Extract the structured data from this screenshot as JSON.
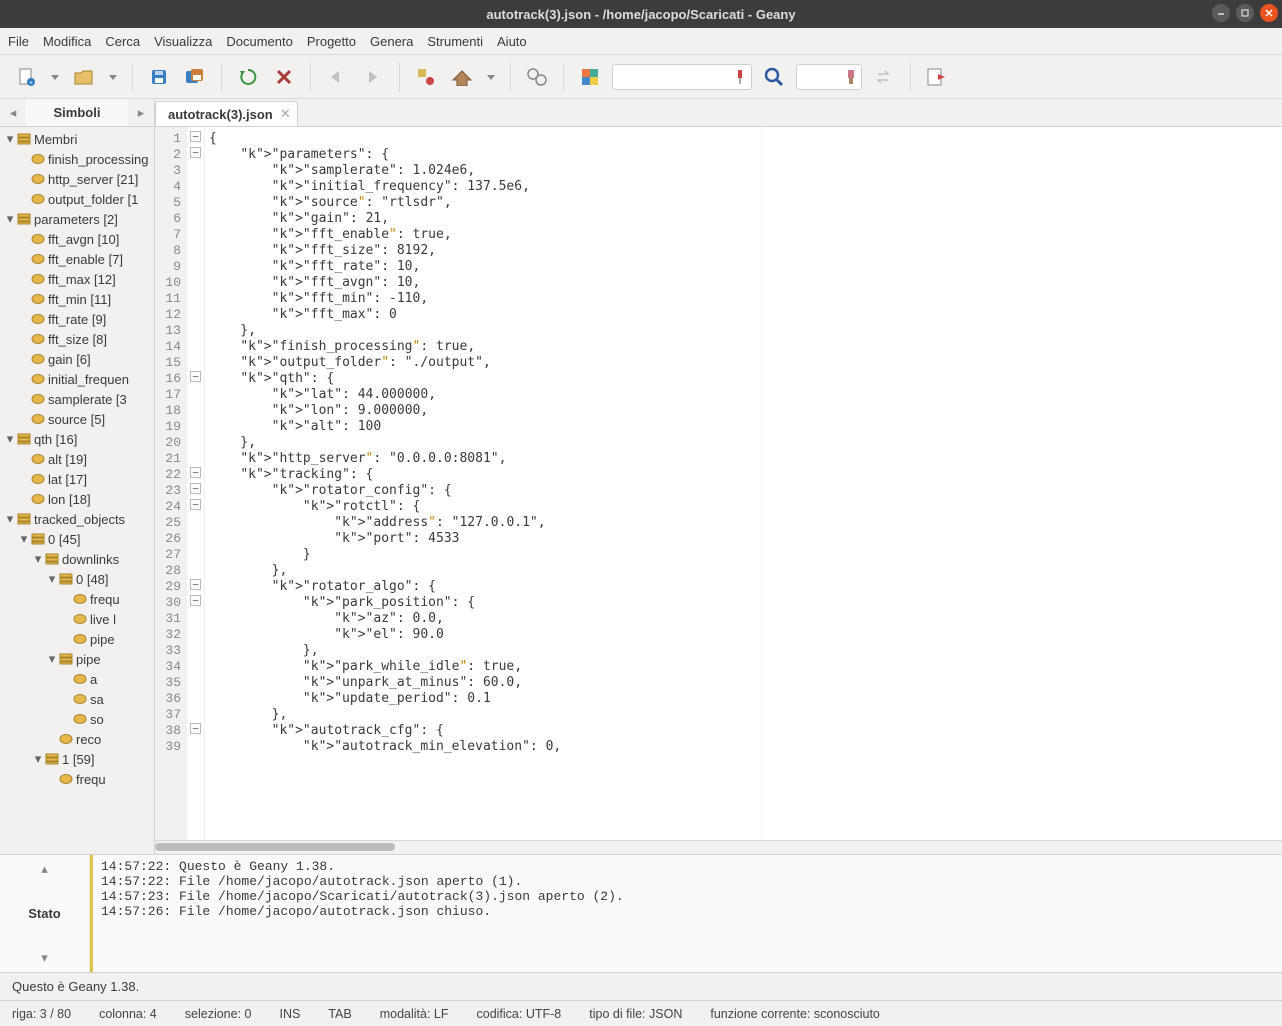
{
  "window_title": "autotrack(3).json - /home/jacopo/Scaricati - Geany",
  "menus": [
    "File",
    "Modifica",
    "Cerca",
    "Visualizza",
    "Documento",
    "Progetto",
    "Genera",
    "Strumenti",
    "Aiuto"
  ],
  "sidebar": {
    "tab_label": "Simboli",
    "groups": [
      {
        "label": "Membri",
        "children": [
          {
            "label": "finish_processing"
          },
          {
            "label": "http_server [21]"
          },
          {
            "label": "output_folder [1"
          }
        ]
      },
      {
        "label": "parameters [2]",
        "children": [
          {
            "label": "fft_avgn [10]"
          },
          {
            "label": "fft_enable [7]"
          },
          {
            "label": "fft_max [12]"
          },
          {
            "label": "fft_min [11]"
          },
          {
            "label": "fft_rate [9]"
          },
          {
            "label": "fft_size [8]"
          },
          {
            "label": "gain [6]"
          },
          {
            "label": "initial_frequen"
          },
          {
            "label": "samplerate [3"
          },
          {
            "label": "source [5]"
          }
        ]
      },
      {
        "label": "qth [16]",
        "children": [
          {
            "label": "alt [19]"
          },
          {
            "label": "lat [17]"
          },
          {
            "label": "lon [18]"
          }
        ]
      },
      {
        "label": "tracked_objects",
        "children": [
          {
            "label": "0 [45]",
            "children": [
              {
                "label": "downlinks",
                "children": [
                  {
                    "label": "0 [48]",
                    "children": [
                      {
                        "label": "frequ"
                      },
                      {
                        "label": "live l"
                      },
                      {
                        "label": "pipe"
                      }
                    ]
                  },
                  {
                    "label": "pipe",
                    "children": [
                      {
                        "label": "a"
                      },
                      {
                        "label": "sa"
                      },
                      {
                        "label": "so"
                      }
                    ]
                  },
                  {
                    "label": "reco"
                  }
                ]
              },
              {
                "label": "1 [59]",
                "children": [
                  {
                    "label": "frequ"
                  }
                ]
              }
            ]
          }
        ]
      }
    ]
  },
  "open_tab": "autotrack(3).json",
  "line_count": 39,
  "code_lines": [
    "{",
    "    \"parameters\": {",
    "        \"samplerate\": 1.024e6,",
    "        \"initial_frequency\": 137.5e6,",
    "        \"source\": \"rtlsdr\",",
    "        \"gain\": 21,",
    "        \"fft_enable\": true,",
    "        \"fft_size\": 8192,",
    "        \"fft_rate\": 10,",
    "        \"fft_avgn\": 10,",
    "        \"fft_min\": -110,",
    "        \"fft_max\": 0",
    "    },",
    "    \"finish_processing\": true,",
    "    \"output_folder\": \"./output\",",
    "    \"qth\": {",
    "        \"lat\": 44.000000,",
    "        \"lon\": 9.000000,",
    "        \"alt\": 100",
    "    },",
    "    \"http_server\": \"0.0.0.0:8081\",",
    "    \"tracking\": {",
    "        \"rotator_config\": {",
    "            \"rotctl\": {",
    "                \"address\": \"127.0.0.1\",",
    "                \"port\": 4533",
    "            }",
    "        },",
    "        \"rotator_algo\": {",
    "            \"park_position\": {",
    "                \"az\": 0.0,",
    "                \"el\": 90.0",
    "            },",
    "            \"park_while_idle\": true,",
    "            \"unpark_at_minus\": 60.0,",
    "            \"update_period\": 0.1",
    "        },",
    "        \"autotrack_cfg\": {",
    "            \"autotrack_min_elevation\": 0,"
  ],
  "log": [
    "14:57:22: Questo è Geany 1.38.",
    "14:57:22: File /home/jacopo/autotrack.json aperto (1).",
    "14:57:23: File /home/jacopo/Scaricati/autotrack(3).json aperto (2).",
    "14:57:26: File /home/jacopo/autotrack.json chiuso."
  ],
  "bottom_tab": "Stato",
  "messagebar": "Questo è Geany 1.38.",
  "status": {
    "pos": "riga: 3 / 80",
    "col": "colonna: 4",
    "sel": "selezione: 0",
    "ins": "INS",
    "tab": "TAB",
    "eol": "modalità: LF",
    "enc": "codifica: UTF-8",
    "ftype": "tipo di file: JSON",
    "scope": "funzione corrente: sconosciuto"
  }
}
